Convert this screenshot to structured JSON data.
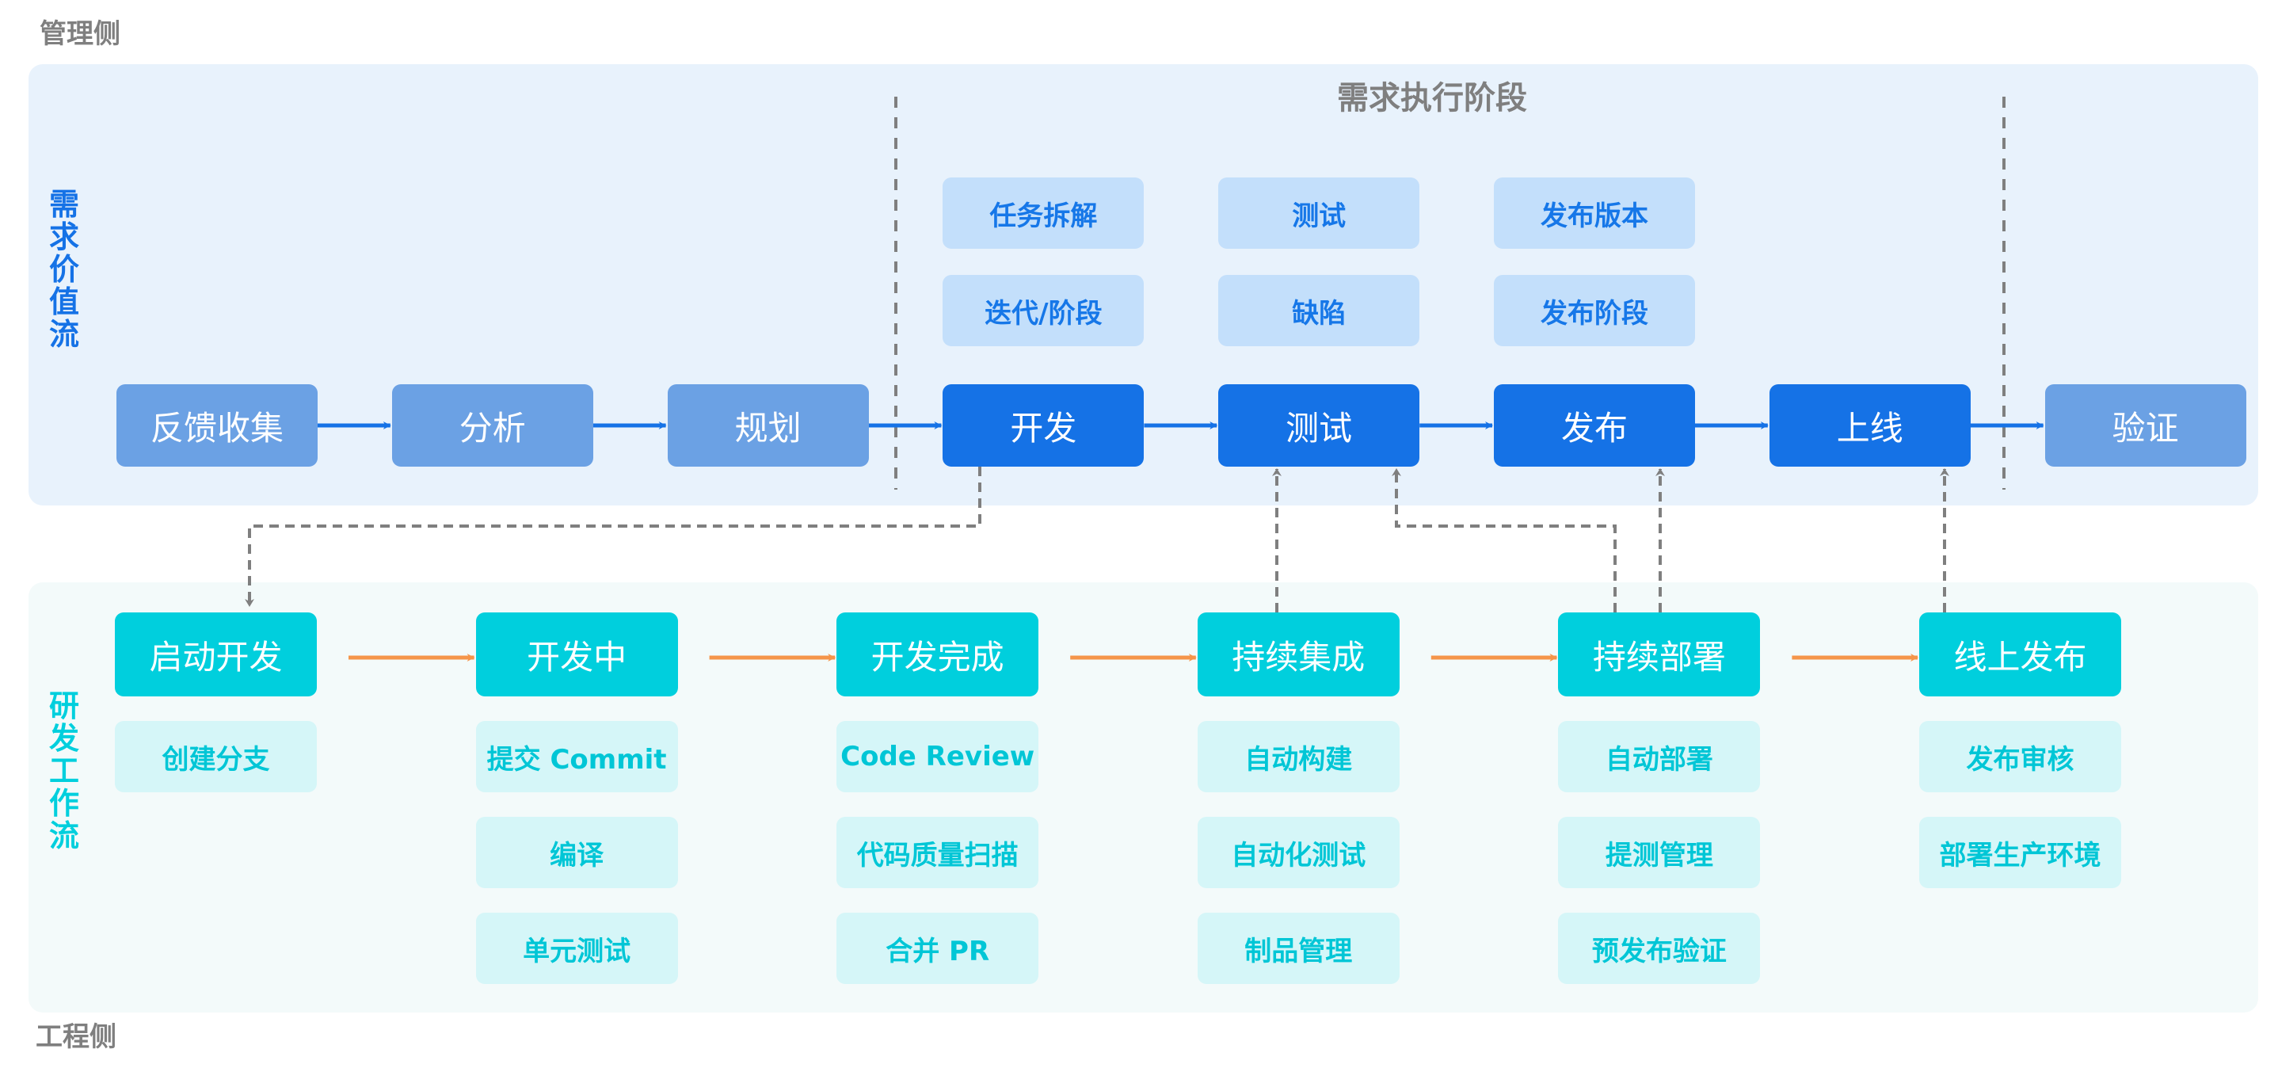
{
  "labels": {
    "management_side": "管理侧",
    "engineering_side": "工程侧",
    "demand_value_stream": "需求价值流",
    "dev_workflow": "研发工作流",
    "execution_phase": "需求执行阶段"
  },
  "colors": {
    "demand_panel_bg": "#e8f2fc",
    "dev_panel_bg": "#f3fafa",
    "demand_primary": "#1572e6",
    "demand_secondary": "#6ba1e4",
    "demand_task_bg": "#c3dffb",
    "dev_primary": "#00cfdd",
    "dev_sub_bg": "#d5f6f8",
    "dev_arrow": "#f5954a",
    "connector": "#7f7f7f",
    "side_label": "#7f7f7f"
  },
  "demand_flow": [
    {
      "label": "反馈收集",
      "style": "secondary"
    },
    {
      "label": "分析",
      "style": "secondary"
    },
    {
      "label": "规划",
      "style": "secondary"
    },
    {
      "label": "开发",
      "style": "primary"
    },
    {
      "label": "测试",
      "style": "primary"
    },
    {
      "label": "发布",
      "style": "primary"
    },
    {
      "label": "上线",
      "style": "primary"
    },
    {
      "label": "验证",
      "style": "secondary"
    }
  ],
  "execution_tasks": [
    [
      "任务拆解",
      "迭代/阶段"
    ],
    [
      "测试",
      "缺陷"
    ],
    [
      "发布版本",
      "发布阶段"
    ]
  ],
  "dev_flow": [
    {
      "label": "启动开发",
      "subs": [
        "创建分支"
      ]
    },
    {
      "label": "开发中",
      "subs": [
        "提交 Commit",
        "编译",
        "单元测试"
      ]
    },
    {
      "label": "开发完成",
      "subs": [
        "Code Review",
        "代码质量扫描",
        "合并 PR"
      ]
    },
    {
      "label": "持续集成",
      "subs": [
        "自动构建",
        "自动化测试",
        "制品管理"
      ]
    },
    {
      "label": "持续部署",
      "subs": [
        "自动部署",
        "提测管理",
        "预发布验证"
      ]
    },
    {
      "label": "线上发布",
      "subs": [
        "发布审核",
        "部署生产环境"
      ]
    }
  ],
  "links": [
    {
      "from": "开发",
      "to": "启动开发",
      "direction": "down"
    },
    {
      "from": "持续集成",
      "to": "测试",
      "direction": "up"
    },
    {
      "from": "持续部署",
      "to": "测试",
      "direction": "up"
    },
    {
      "from": "持续部署",
      "to": "发布",
      "direction": "up"
    },
    {
      "from": "线上发布",
      "to": "上线",
      "direction": "up"
    }
  ]
}
